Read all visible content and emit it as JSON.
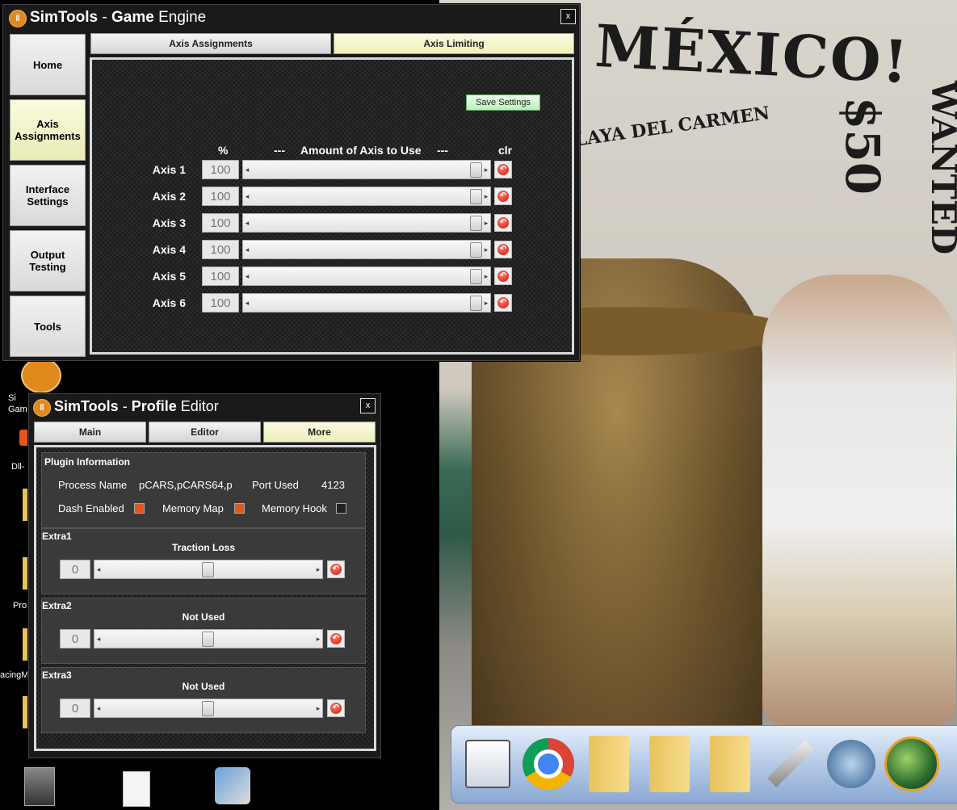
{
  "wallpaper": {
    "sign_main": "NA MÉXICO!",
    "sign_sub": "PLAYA DEL CARMEN",
    "sign_price": "$50",
    "sign_right": "WANTED"
  },
  "desktop": {
    "icons": [
      {
        "label": "Si\nGam",
        "icon": "simtools-icon"
      },
      {
        "label": "Dll-",
        "icon": "dll-icon"
      },
      {
        "label": "Pro",
        "icon": "folder-icon"
      },
      {
        "label": "acingM",
        "icon": "folder-icon"
      }
    ]
  },
  "game_engine": {
    "title_brand": "SimTools",
    "title_sep": " - ",
    "title_bold": "Game",
    "title_rest": " Engine",
    "close": "x",
    "nav": [
      "Home",
      "Axis\nAssignments",
      "Interface\nSettings",
      "Output\nTesting",
      "Tools"
    ],
    "nav_active_index": 1,
    "tabs": [
      "Axis Assignments",
      "Axis Limiting"
    ],
    "tab_active_index": 1,
    "save_label": "Save Settings",
    "col_percent": "%",
    "col_amount": "---     Amount of Axis to Use     ---",
    "col_clr": "clr",
    "axes": [
      {
        "label": "Axis 1",
        "value": "100",
        "percent": 100
      },
      {
        "label": "Axis 2",
        "value": "100",
        "percent": 100
      },
      {
        "label": "Axis 3",
        "value": "100",
        "percent": 100
      },
      {
        "label": "Axis 4",
        "value": "100",
        "percent": 100
      },
      {
        "label": "Axis 5",
        "value": "100",
        "percent": 100
      },
      {
        "label": "Axis 6",
        "value": "100",
        "percent": 100
      }
    ]
  },
  "profile_editor": {
    "title_brand": "SimTools",
    "title_sep": " - ",
    "title_bold": "Profile",
    "title_rest": " Editor",
    "close": "x",
    "tabs": [
      "Main",
      "Editor",
      "More"
    ],
    "tab_active_index": 2,
    "plugin_info": {
      "title": "Plugin Information",
      "process_label": "Process Name",
      "process_value": "pCARS,pCARS64,p",
      "port_label": "Port Used",
      "port_value": "4123",
      "dash_label": "Dash Enabled",
      "dash_checked": true,
      "memmap_label": "Memory Map",
      "memmap_checked": true,
      "memhook_label": "Memory Hook",
      "memhook_checked": false
    },
    "extras": [
      {
        "title": "Extra1",
        "name": "Traction Loss",
        "value": "0"
      },
      {
        "title": "Extra2",
        "name": "Not Used",
        "value": "0"
      },
      {
        "title": "Extra3",
        "name": "Not Used",
        "value": "0"
      }
    ]
  },
  "dock": {
    "items": [
      "system-preferences-icon",
      "chrome-icon",
      "documents-folder-icon",
      "folder-icon",
      "folder-icon",
      "utilities-icon",
      "teamspeak-icon",
      "globe-icon"
    ]
  },
  "colors": {
    "check_on": "#e2571e",
    "active_tab": "#eef0b8",
    "save_green": "#b9f0b9"
  }
}
